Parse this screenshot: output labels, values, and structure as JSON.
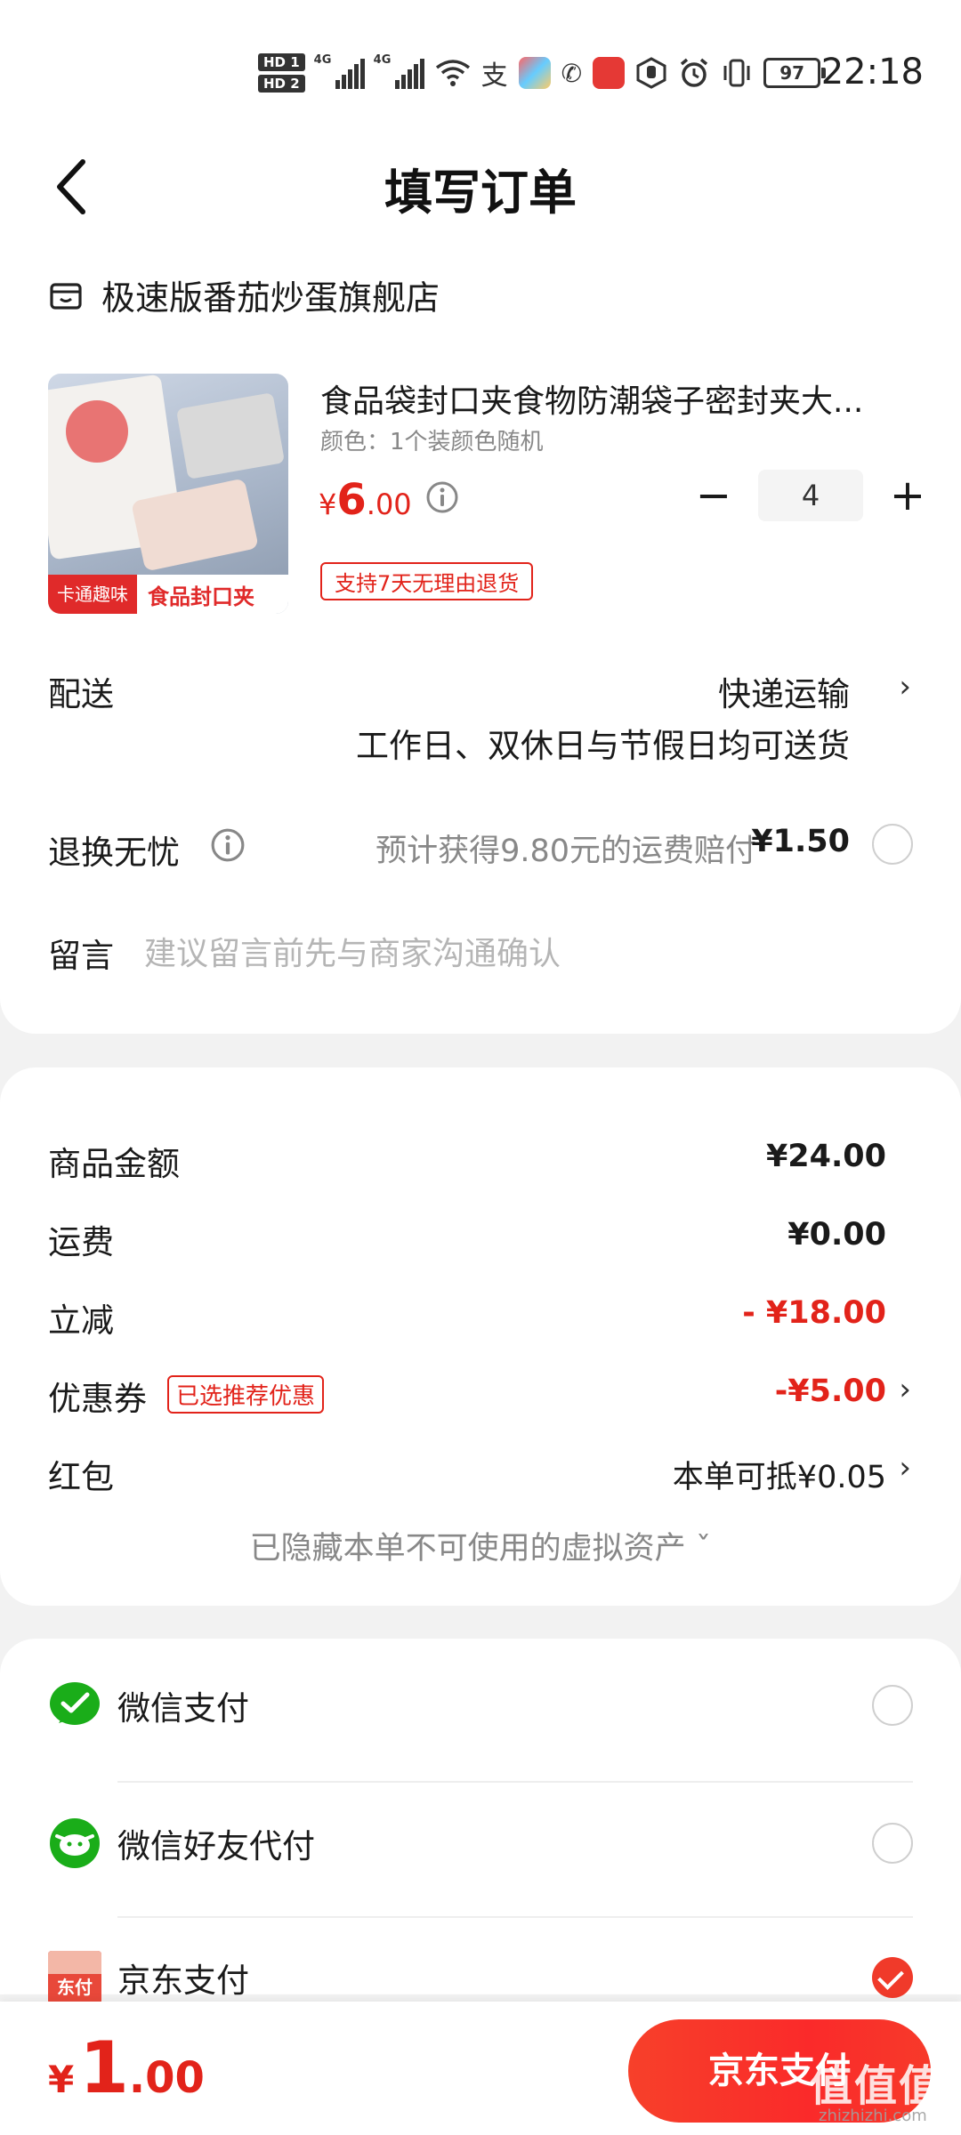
{
  "status_bar": {
    "hd1": "HD 1",
    "hd2": "HD 2",
    "net1": "4G",
    "net2": "4G",
    "alipay_glyph": "支",
    "wechat_glyph": "✆",
    "battery": "97",
    "time": "22:18"
  },
  "header": {
    "title": "填写订单"
  },
  "store": {
    "name": "极速版番茄炒蛋旗舰店"
  },
  "product": {
    "title": "食品袋封口夹食物防潮袋子密封夹大...",
    "spec": "颜色：1个装颜色随机",
    "price_symbol": "¥",
    "price_int": "6",
    "price_dec": ".00",
    "quantity": "4",
    "minus": "−",
    "plus": "+",
    "return_policy": "支持7天无理由退货",
    "image_tag": "卡通趣味",
    "image_caption": "食品封口夹"
  },
  "delivery": {
    "label": "配送",
    "method": "快递运输",
    "note": "工作日、双休日与节假日均可送货"
  },
  "return_insurance": {
    "label": "退换无忧",
    "text": "预计获得9.80元的运费赔付",
    "price": "¥1.50"
  },
  "message": {
    "label": "留言",
    "placeholder": "建议留言前先与商家沟通确认"
  },
  "summary": {
    "goods_label": "商品金额",
    "goods_value": "¥24.00",
    "shipping_label": "运费",
    "shipping_value": "¥0.00",
    "discount_label": "立减",
    "discount_value": "- ¥18.00",
    "coupon_label": "优惠券",
    "coupon_badge": "已选推荐优惠",
    "coupon_value": "-¥5.00",
    "redpacket_label": "红包",
    "redpacket_value": "本单可抵¥0.05",
    "hidden_assets": "已隐藏本单不可使用的虚拟资产 ˇ"
  },
  "payment": {
    "wechat_pay": "微信支付",
    "wechat_friend": "微信好友代付",
    "jd_pay": "京东支付",
    "jd_icon_text": "东付",
    "selected": "jd_pay"
  },
  "bottom": {
    "total_symbol": "¥",
    "total_int": "1",
    "total_dec": ".00",
    "pay_button": "京东支付",
    "watermark": "值值值",
    "watermark_sub": "zhizhizhi.com"
  },
  "colors": {
    "accent_red": "#e2231a",
    "wechat_green": "#1aad19"
  }
}
